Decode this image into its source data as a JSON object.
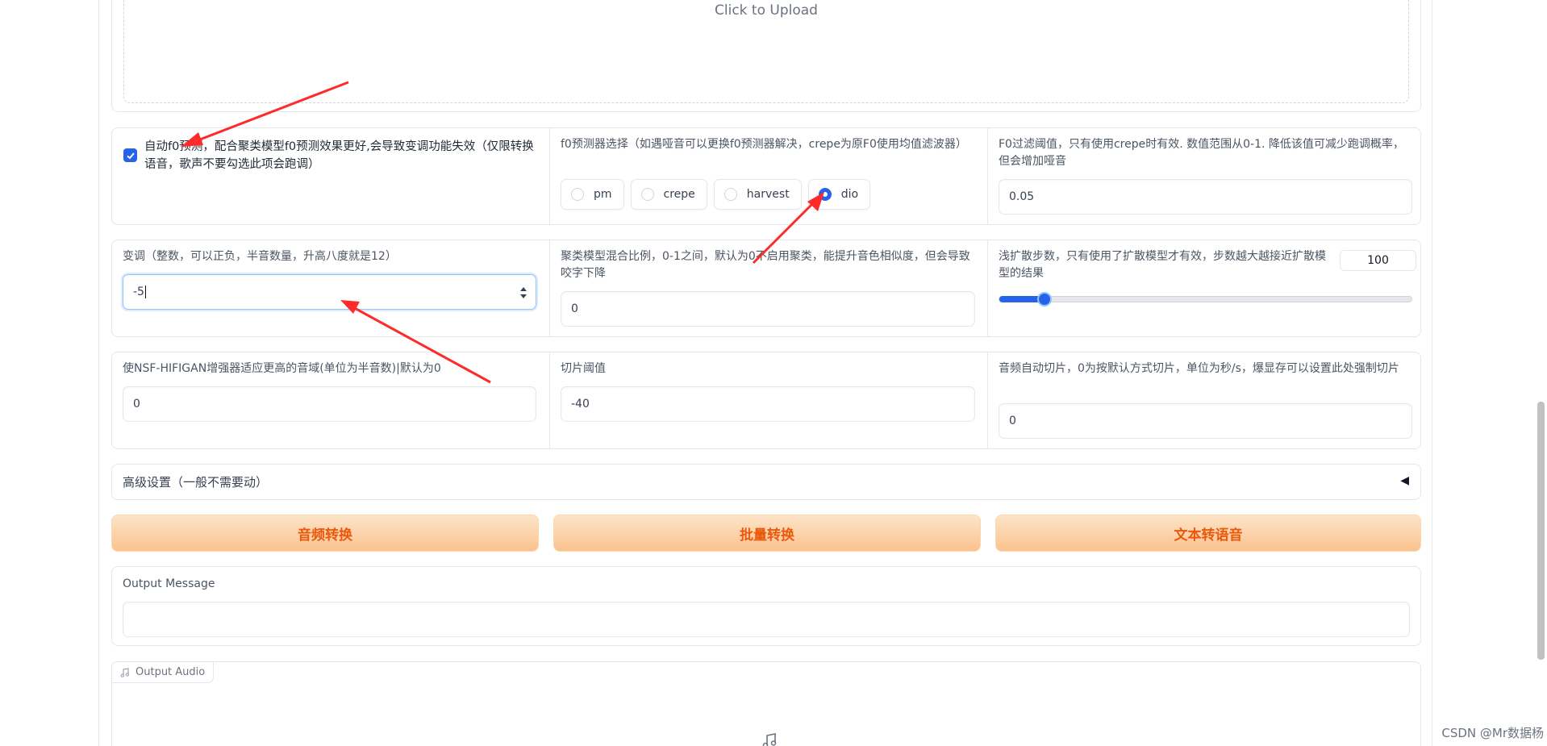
{
  "upload": {
    "text": "Click to Upload"
  },
  "f0_auto": {
    "checked": true,
    "label": "自动f0预测，配合聚类模型f0预测效果更好,会导致变调功能失效（仅限转换语音，歌声不要勾选此项会跑调）"
  },
  "f0_predictor": {
    "label": "f0预测器选择（如遇哑音可以更换f0预测器解决，crepe为原F0使用均值滤波器）",
    "options": [
      "pm",
      "crepe",
      "harvest",
      "dio"
    ],
    "selected": "dio"
  },
  "f0_filter": {
    "label": "F0过滤阈值，只有使用crepe时有效. 数值范围从0-1. 降低该值可减少跑调概率，但会增加哑音",
    "value": "0.05"
  },
  "transpose": {
    "label": "变调（整数，可以正负，半音数量，升高八度就是12）",
    "value": "-5"
  },
  "cluster_ratio": {
    "label": "聚类模型混合比例，0-1之间，默认为0不启用聚类，能提升音色相似度，但会导致咬字下降",
    "value": "0"
  },
  "diffusion_steps": {
    "label": "浅扩散步数，只有使用了扩散模型才有效，步数越大越接近扩散模型的结果",
    "value": "100",
    "slider_fraction": 0.11
  },
  "nsf_hifigan": {
    "label": "使NSF-HIFIGAN增强器适应更高的音域(单位为半音数)|默认为0",
    "value": "0"
  },
  "slice_threshold": {
    "label": "切片阈值",
    "value": "-40"
  },
  "auto_slice": {
    "label": "音频自动切片，0为按默认方式切片，单位为秒/s，爆显存可以设置此处强制切片",
    "value": "0"
  },
  "advanced": {
    "label": "高级设置（一般不需要动）",
    "arrow": "◀"
  },
  "buttons": {
    "audio_convert": "音频转换",
    "batch_convert": "批量转换",
    "tts": "文本转语音"
  },
  "output_message": {
    "label": "Output Message",
    "value": ""
  },
  "output_audio": {
    "label": "Output Audio"
  },
  "watermark": "CSDN @Mr数据杨"
}
